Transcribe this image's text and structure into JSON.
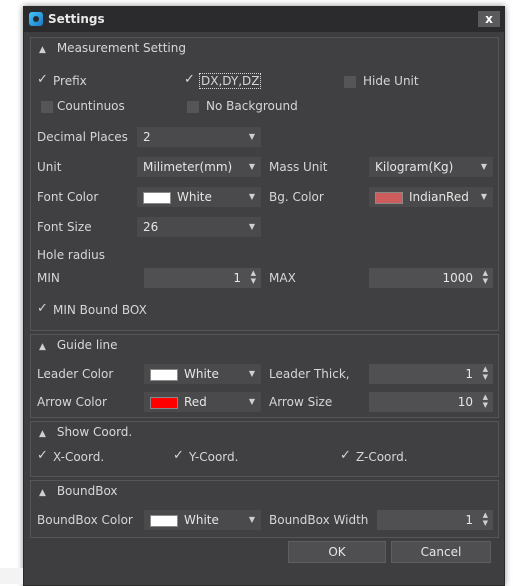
{
  "window": {
    "title": "Settings",
    "close_label": "x"
  },
  "measurement": {
    "header": "Measurement Setting",
    "prefix": {
      "label": "Prefix",
      "checked": true
    },
    "dxdydz": {
      "label": "DX,DY,DZ",
      "checked": true
    },
    "hide_unit": {
      "label": "Hide Unit",
      "checked": false
    },
    "continuous": {
      "label": "Countinuos",
      "checked": false
    },
    "no_background": {
      "label": "No Background",
      "checked": false
    },
    "decimal_places": {
      "label": "Decimal Places",
      "value": "2"
    },
    "unit": {
      "label": "Unit",
      "value": "Milimeter(mm)"
    },
    "mass_unit": {
      "label": "Mass Unit",
      "value": "Kilogram(Kg)"
    },
    "font_color": {
      "label": "Font Color",
      "value": "White",
      "swatch": "#ffffff"
    },
    "bg_color": {
      "label": "Bg. Color",
      "value": "IndianRed",
      "swatch": "#cd5c5c"
    },
    "font_size": {
      "label": "Font Size",
      "value": "26"
    },
    "hole_radius": {
      "label": "Hole radius"
    },
    "min": {
      "label": "MIN",
      "value": "1"
    },
    "max": {
      "label": "MAX",
      "value": "1000"
    },
    "min_bound_box": {
      "label": "MIN Bound BOX",
      "checked": true
    }
  },
  "guide_line": {
    "header": "Guide line",
    "leader_color": {
      "label": "Leader Color",
      "value": "White",
      "swatch": "#ffffff"
    },
    "leader_thick": {
      "label": "Leader Thick,",
      "value": "1"
    },
    "arrow_color": {
      "label": "Arrow Color",
      "value": "Red",
      "swatch": "#ff0000"
    },
    "arrow_size": {
      "label": "Arrow Size",
      "value": "10"
    }
  },
  "show_coord": {
    "header": "Show Coord.",
    "x": {
      "label": "X-Coord.",
      "checked": true
    },
    "y": {
      "label": "Y-Coord.",
      "checked": true
    },
    "z": {
      "label": "Z-Coord.",
      "checked": true
    }
  },
  "boundbox": {
    "header": "BoundBox",
    "color": {
      "label": "BoundBox Color",
      "value": "White",
      "swatch": "#ffffff"
    },
    "width": {
      "label": "BoundBox Width",
      "value": "1"
    }
  },
  "buttons": {
    "ok": "OK",
    "cancel": "Cancel"
  },
  "glyphs": {
    "check": "✓",
    "caret_up": "▲",
    "dropdown": "▼",
    "spin_up": "▲",
    "spin_down": "▼"
  }
}
